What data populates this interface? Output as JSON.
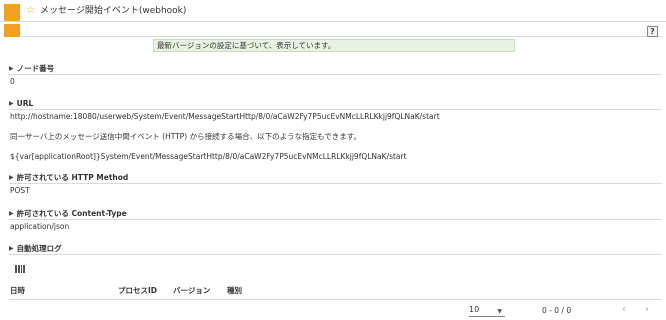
{
  "window": {
    "title": "メッセージ開始イベント(webhook)",
    "title_icon": "star-icon",
    "accent_color": "#f0a024"
  },
  "toolbar": {
    "help_label": "?"
  },
  "notice": {
    "text": "最新バージョンの設定に基づいて、表示しています。",
    "background": "#e7f2e2"
  },
  "sections": {
    "node_number": {
      "label": "ノード番号",
      "value": "0"
    },
    "url": {
      "label": "URL",
      "value": "http://hostname:18080/userweb/System/Event/MessageStartHttp/8/0/aCaW2Fy7P5ucEvNMcLLRLKkjj9fQLNaK/start",
      "note": "同一サーバ上のメッセージ送信中間イベント (HTTP) から接続する場合、以下のような指定もできます。",
      "alt_value": "${var[applicationRoot]}System/Event/MessageStartHttp/8/0/aCaW2Fy7P5ucEvNMcLLRLKkjj9fQLNaK/start"
    },
    "http_method": {
      "label": "許可されている HTTP Method",
      "value": "POST"
    },
    "content_type": {
      "label": "許可されている Content-Type",
      "value": "application/json"
    },
    "auto_log": {
      "label": "自動処理ログ"
    }
  },
  "log_table": {
    "columns_icon": "columns-icon",
    "headers": [
      "日時",
      "プロセスID",
      "バージョン",
      "種別"
    ],
    "rows": []
  },
  "pager": {
    "page_size": "10",
    "range": "0 - 0 / 0",
    "prev_symbol": "‹",
    "next_symbol": "›"
  }
}
